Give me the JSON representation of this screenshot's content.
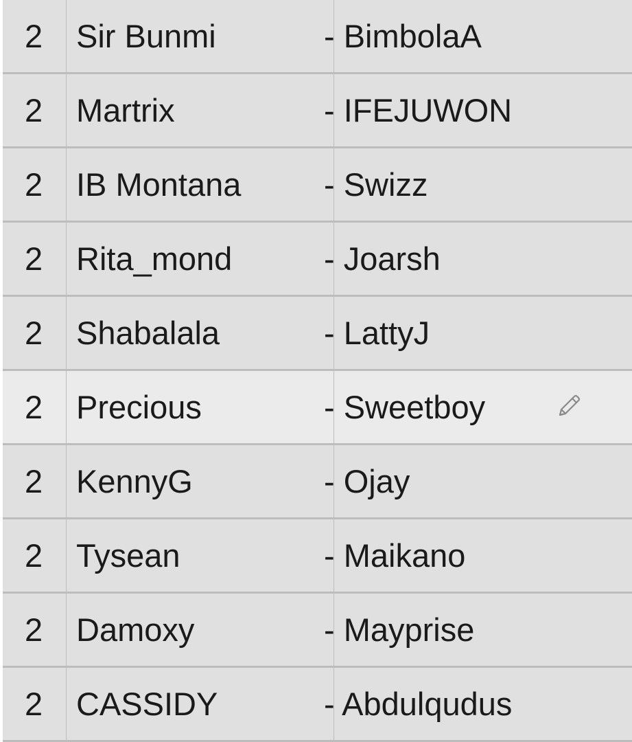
{
  "rows": [
    {
      "count": "2",
      "name": "Sir Bunmi",
      "match": "- BimbolaA"
    },
    {
      "count": "2",
      "name": "Martrix",
      "match": "- IFEJUWON"
    },
    {
      "count": "2",
      "name": "IB Montana",
      "match": "- Swizz"
    },
    {
      "count": "2",
      "name": "Rita_mond",
      "match": "- Joarsh"
    },
    {
      "count": "2",
      "name": "Shabalala",
      "match": "- LattyJ"
    },
    {
      "count": "2",
      "name": "Precious",
      "match": "- Sweetboy"
    },
    {
      "count": "2",
      "name": "KennyG",
      "match": "- Ojay"
    },
    {
      "count": "2",
      "name": "Tysean",
      "match": "- Maikano"
    },
    {
      "count": "2",
      "name": "Damoxy",
      "match": "- Mayprise"
    },
    {
      "count": "2",
      "name": "CASSIDY",
      "match": "- Abdulqudus"
    }
  ],
  "highlighted_row": 5,
  "edit_icon": "pencil-icon",
  "colors": {
    "cell": "#e0e0e0",
    "cell_highlight": "#ebebeb",
    "grid_line": "#bdbdbd",
    "text": "#1a1a1a",
    "icon": "#8a8a8a"
  }
}
